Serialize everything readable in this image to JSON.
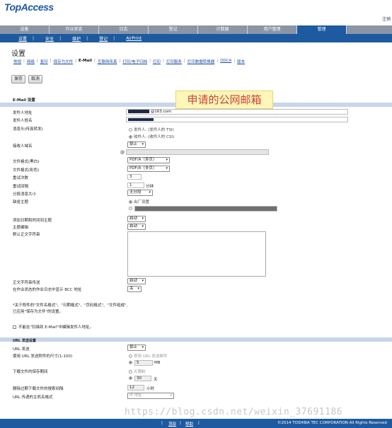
{
  "app": {
    "logo": "TopAccess",
    "logout": "注销"
  },
  "tabs": [
    "设备",
    "作业状态",
    "日志",
    "登记",
    "计数器",
    "用户管理",
    "管理"
  ],
  "subtabs": [
    "设置",
    "安全",
    "维护",
    "登记",
    "AirPrint"
  ],
  "page": {
    "title": "设置"
  },
  "links": [
    "常规",
    "网络",
    "复印",
    "保存为文件",
    "E-Mail",
    "互联网传真",
    "打印/电子归档",
    "打印",
    "打印服务",
    "打印数据转换器",
    "ODCA",
    "版本"
  ],
  "buttons": {
    "save": "保存",
    "cancel": "取消"
  },
  "section1": {
    "title": "E-Mail 设置"
  },
  "banner": "申请的公网邮箱",
  "labels": {
    "from_addr": "发件人地址",
    "from_name": "发件人姓名",
    "header": "消息头(传真转发)",
    "receiver_domain": "接收人域名",
    "file_format_mono": "文件格式(黑白)",
    "file_format_color": "文件格式(彩色)",
    "retry_count": "重试次数",
    "retry_interval": "重试间隔",
    "fragment_size": "分段消息大小",
    "default_subject": "缺省主题",
    "add_date": "添加日期和时间到主题",
    "subject_edit": "主题编辑",
    "default_body": "默认正文字符串",
    "body_send": "正文字符串传送",
    "bcc": "在作业状态的作业日志中显示 BCC 地址"
  },
  "values": {
    "from_addr_suffix": "@163.com",
    "header_opt1": "发件人: (发件人的 TSI)",
    "header_opt2": "收件人: (收件人的 CSI)",
    "receiver_domain": "禁止",
    "at": "@",
    "file_format_mono": "PDF/A（多页）",
    "file_format_color": "PDF/A（多页）",
    "retry_count": "3",
    "retry_interval": "1",
    "retry_unit": "分钟",
    "fragment_size": "无分段",
    "subject_opt1": "出厂设置",
    "add_date": "启动",
    "subject_edit": "启动",
    "body_send": "启动",
    "bcc": "关"
  },
  "notes": [
    "*关于附件的\"文件名格式\"、\"日期格式\"、\"页码格式\"、\"文件组成\",",
    "已应用\"保存为文件\"的设置。",
    "不能在\"扫描到 E-Mail\"中编辑发件人地址。"
  ],
  "section2": {
    "title": "URL 发送设置"
  },
  "labels2": {
    "url_send": "URL 发送",
    "url_size": "使用 URL 发送附件的尺寸(1-100)",
    "save_period": "下载文件的保存期间",
    "delete_interval": "删除过期下载文件的搜索间隔",
    "hostname": "URL 传递的主机名格式"
  },
  "values2": {
    "url_send": "禁止",
    "url_opt1": "常用 URL 发送邮件",
    "url_size": "5",
    "url_unit": "MB",
    "period_opt1": "无限制",
    "period": "30",
    "period_unit": "天",
    "delete_interval": "12",
    "delete_unit": "小时",
    "hostname": "IP 地址"
  },
  "watermark": "https://blog.csdn.net/weixin_37691186",
  "footer": {
    "links": [
      "顶部",
      "帮助"
    ],
    "copyright": "©2014 TOSHIBA TEC CORPORATION All Rights Reserved"
  }
}
